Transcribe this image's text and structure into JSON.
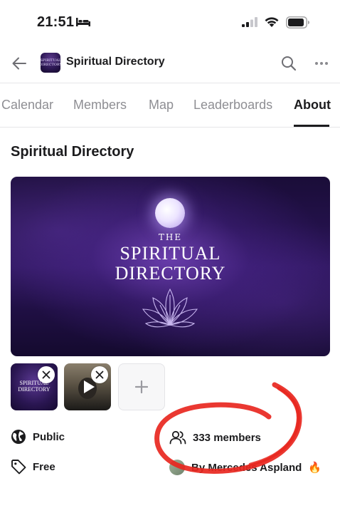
{
  "status_bar": {
    "time": "21:51"
  },
  "header": {
    "title": "Spiritual Directory",
    "avatar_text": "SPIRITUAL DIRECTORY"
  },
  "tabs": [
    {
      "label": "Calendar",
      "active": false
    },
    {
      "label": "Members",
      "active": false
    },
    {
      "label": "Map",
      "active": false
    },
    {
      "label": "Leaderboards",
      "active": false
    },
    {
      "label": "About",
      "active": true
    }
  ],
  "page": {
    "title": "Spiritual Directory"
  },
  "cover": {
    "the": "THE",
    "line1": "SPIRITUAL",
    "line2": "DIRECTORY"
  },
  "thumbnails": {
    "first_text_line1": "SPIRITUAL",
    "first_text_line2": "DIRECTORY"
  },
  "info": {
    "privacy": "Public",
    "members": "333 members",
    "price": "Free",
    "owner": "By Mercedes Aspland",
    "owner_emoji": "🔥"
  },
  "colors": {
    "annotation": "#e8271f",
    "cover_bg": "#2a1458",
    "text": "#1c1c1e",
    "muted": "#8e8e93"
  },
  "icons": [
    "bed-icon",
    "signal-icon",
    "wifi-icon",
    "battery-icon",
    "back-arrow-icon",
    "search-icon",
    "more-icon",
    "lotus-icon",
    "play-icon",
    "close-icon",
    "plus-icon",
    "globe-icon",
    "members-icon",
    "tag-icon",
    "fire-icon"
  ]
}
